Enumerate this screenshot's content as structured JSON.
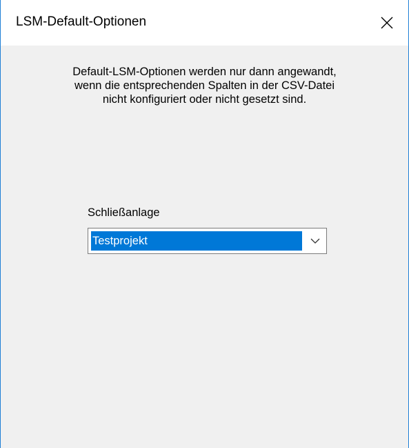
{
  "window": {
    "title": "LSM-Default-Optionen",
    "accent_color": "#1e7fd6"
  },
  "titlebar": {
    "close_icon": "close-icon"
  },
  "info": {
    "lines": [
      "Default-LSM-Optionen werden nur dann angewandt,",
      "wenn die entsprechenden Spalten in der CSV-Datei",
      "nicht konfiguriert oder nicht gesetzt sind."
    ]
  },
  "schliessanlage": {
    "label": "Schließanlage",
    "selected_value": "Testprojekt",
    "selection_color": "#0078d7",
    "dropdown_icon": "chevron-down-icon"
  }
}
